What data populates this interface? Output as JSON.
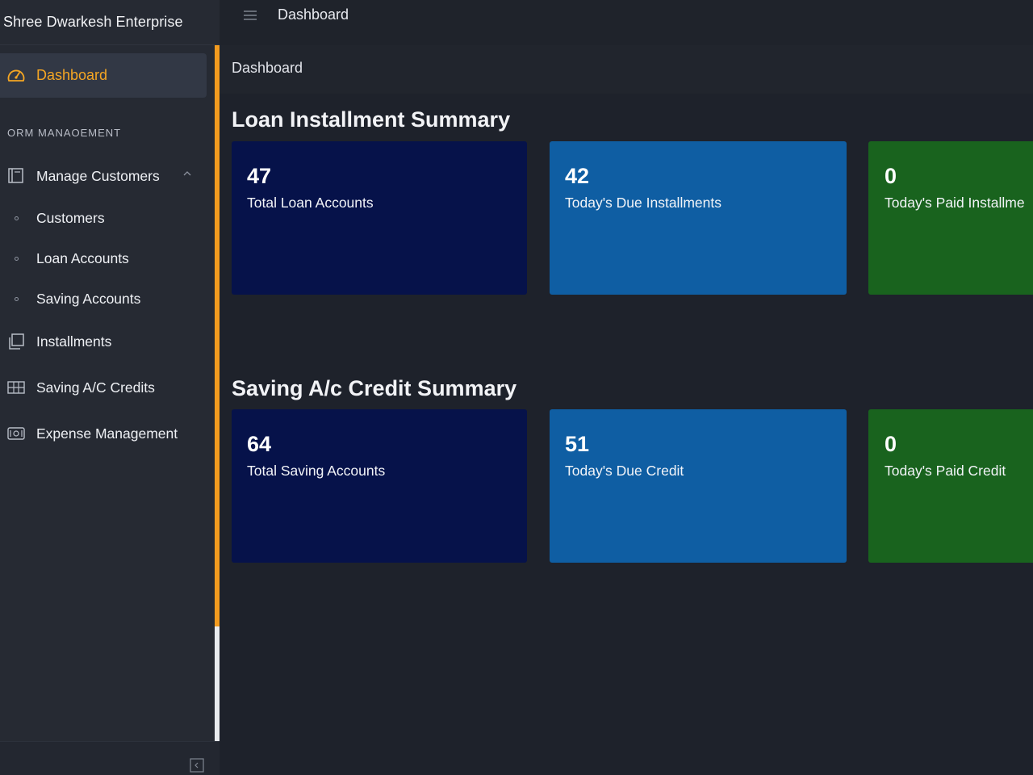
{
  "app": {
    "brand": "Shree Dwarkesh Enterprise"
  },
  "topbar": {
    "title": "Dashboard"
  },
  "breadcrumb": {
    "current": "Dashboard"
  },
  "sidebar": {
    "active_item": "Dashboard",
    "section_label": "ORM MANAOEMENT",
    "items": {
      "manage_customers": "Manage Customers",
      "customers": "Customers",
      "loan_accounts": "Loan Accounts",
      "saving_accounts": "Saving Accounts",
      "installments": "Installments",
      "saving_credits": "Saving A/C Credits",
      "expense_management": "Expense Management"
    }
  },
  "loan_summary": {
    "title": "Loan Installment Summary",
    "cards": [
      {
        "value": "47",
        "label": "Total Loan Accounts"
      },
      {
        "value": "42",
        "label": "Today's Due Installments"
      },
      {
        "value": "0",
        "label": "Today's Paid Installme"
      }
    ]
  },
  "saving_summary": {
    "title": "Saving A/c Credit Summary",
    "cards": [
      {
        "value": "64",
        "label": "Total Saving Accounts"
      },
      {
        "value": "51",
        "label": "Today's Due Credit"
      },
      {
        "value": "0",
        "label": "Today's Paid Credit"
      }
    ]
  },
  "colors": {
    "accent": "#f5a623",
    "card_navy": "#06124a",
    "card_blue": "#0f5ea3",
    "card_green": "#19631e"
  },
  "icons": {
    "dashboard": "speedometer-icon",
    "manage_customers": "book-icon",
    "installments": "copy-icon",
    "saving_credits": "table-icon",
    "expense_management": "wallet-icon",
    "menu": "hamburger-icon",
    "collapse": "collapse-left-icon"
  }
}
